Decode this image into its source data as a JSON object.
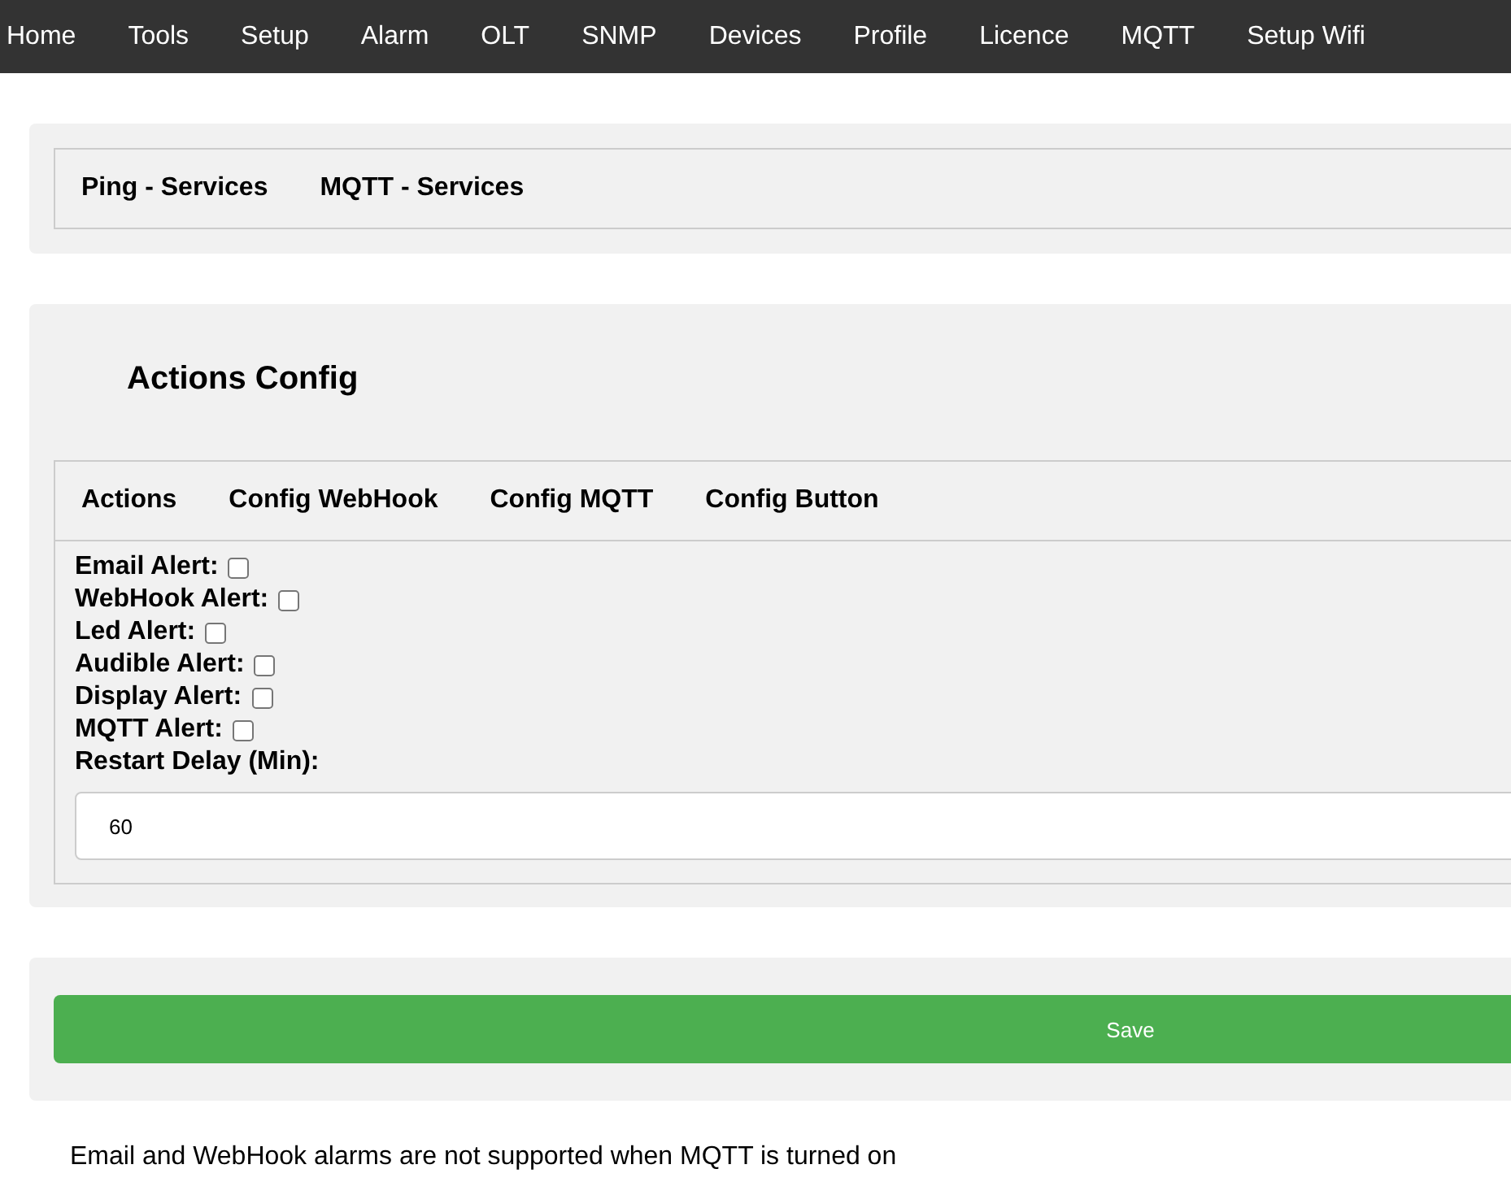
{
  "nav": [
    "Home",
    "Tools",
    "Setup",
    "Alarm",
    "OLT",
    "SNMP",
    "Devices",
    "Profile",
    "Licence",
    "MQTT",
    "Setup Wifi"
  ],
  "service_tabs": [
    "Ping - Services",
    "MQTT - Services"
  ],
  "panel": {
    "title": "Actions Config",
    "tabs": [
      "Actions",
      "Config WebHook",
      "Config MQTT",
      "Config Button"
    ],
    "options": [
      {
        "label": "Email Alert:",
        "checked": false
      },
      {
        "label": "WebHook Alert:",
        "checked": false
      },
      {
        "label": "Led Alert:",
        "checked": false
      },
      {
        "label": "Audible Alert:",
        "checked": false
      },
      {
        "label": "Display Alert:",
        "checked": false
      },
      {
        "label": "MQTT Alert:",
        "checked": false
      }
    ],
    "delay": {
      "label": "Restart Delay (Min):",
      "value": "60"
    }
  },
  "save_button": "Save",
  "note": "Email and WebHook alarms are not supported when MQTT is turned on"
}
